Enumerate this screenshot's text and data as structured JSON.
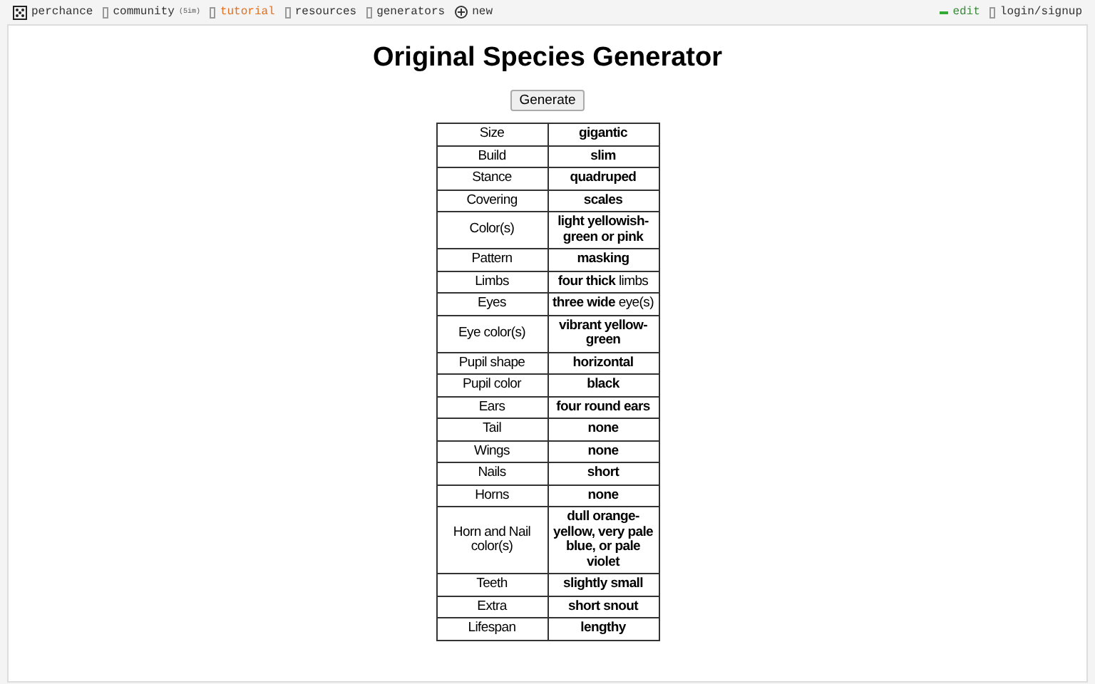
{
  "nav": {
    "left": [
      {
        "kind": "logo",
        "label": "perchance",
        "selected": false
      },
      {
        "kind": "box",
        "label": "community",
        "badge": "(5im)",
        "selected": false
      },
      {
        "kind": "box",
        "label": "tutorial",
        "selected": true
      },
      {
        "kind": "box",
        "label": "resources",
        "selected": false
      },
      {
        "kind": "box",
        "label": "generators",
        "selected": false
      },
      {
        "kind": "plus",
        "label": "new",
        "selected": false
      }
    ],
    "right": [
      {
        "kind": "edit",
        "label": "edit"
      },
      {
        "kind": "box",
        "label": "login/signup"
      }
    ]
  },
  "title": "Original Species Generator",
  "button": "Generate",
  "rows": [
    {
      "label": "Size",
      "value": "gigantic"
    },
    {
      "label": "Build",
      "value": "slim"
    },
    {
      "label": "Stance",
      "value": "quadruped"
    },
    {
      "label": "Covering",
      "value": "scales"
    },
    {
      "label": "Color(s)",
      "value": "light yellowish-green or pink"
    },
    {
      "label": "Pattern",
      "value": "masking"
    },
    {
      "label": "Limbs",
      "value": "**four thick** limbs"
    },
    {
      "label": "Eyes",
      "value": "**three wide** eye(s)"
    },
    {
      "label": "Eye color(s)",
      "value": "vibrant yellow-green"
    },
    {
      "label": "Pupil shape",
      "value": "horizontal"
    },
    {
      "label": "Pupil color",
      "value": "black"
    },
    {
      "label": "Ears",
      "value": "four round ears"
    },
    {
      "label": "Tail",
      "value": "none"
    },
    {
      "label": "Wings",
      "value": "none"
    },
    {
      "label": "Nails",
      "value": "short"
    },
    {
      "label": "Horns",
      "value": "none"
    },
    {
      "label": "Horn and Nail color(s)",
      "value": "dull orange-yellow, very pale blue, or pale violet"
    },
    {
      "label": "Teeth",
      "value": "slightly small"
    },
    {
      "label": "Extra",
      "value": "short snout"
    },
    {
      "label": "Lifespan",
      "value": "lengthy"
    }
  ]
}
